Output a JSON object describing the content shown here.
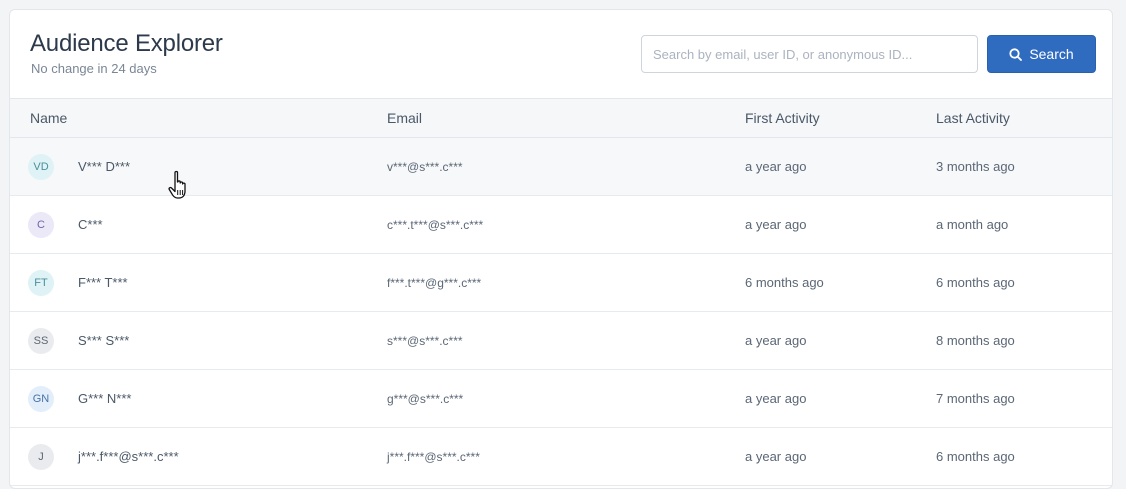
{
  "header": {
    "title": "Audience Explorer",
    "subtitle": "No change in 24 days"
  },
  "search": {
    "placeholder": "Search by email, user ID, or anonymous ID...",
    "value": "",
    "button_label": "Search",
    "button_icon": "search-icon"
  },
  "table": {
    "columns": [
      "Name",
      "Email",
      "First Activity",
      "Last Activity"
    ],
    "rows": [
      {
        "initials": "VD",
        "name": "V*** D***",
        "email": "v***@s***.c***",
        "first": "a year ago",
        "last": "3 months ago",
        "avatar_bg": "#dff2f5",
        "avatar_fg": "#4a8f9c"
      },
      {
        "initials": "C",
        "name": "C***",
        "email": "c***.t***@s***.c***",
        "first": "a year ago",
        "last": "a month ago",
        "avatar_bg": "#ebe8f7",
        "avatar_fg": "#6f66a8"
      },
      {
        "initials": "FT",
        "name": "F*** T***",
        "email": "f***.t***@g***.c***",
        "first": "6 months ago",
        "last": "6 months ago",
        "avatar_bg": "#dff2f5",
        "avatar_fg": "#4a8f9c"
      },
      {
        "initials": "SS",
        "name": "S*** S***",
        "email": "s***@s***.c***",
        "first": "a year ago",
        "last": "8 months ago",
        "avatar_bg": "#e9ebee",
        "avatar_fg": "#5d6773"
      },
      {
        "initials": "GN",
        "name": "G*** N***",
        "email": "g***@s***.c***",
        "first": "a year ago",
        "last": "7 months ago",
        "avatar_bg": "#e3eefb",
        "avatar_fg": "#4a72a6"
      },
      {
        "initials": "J",
        "name": "j***.f***@s***.c***",
        "email": "j***.f***@s***.c***",
        "first": "a year ago",
        "last": "6 months ago",
        "avatar_bg": "#e9ebee",
        "avatar_fg": "#5d6773"
      }
    ]
  },
  "colors": {
    "accent": "#2f6cc0",
    "hover_row": "#f7f8fa"
  }
}
